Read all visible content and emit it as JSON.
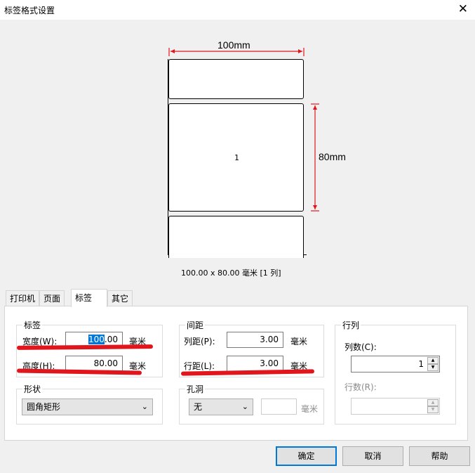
{
  "window": {
    "title": "标签格式设置",
    "close_glyph": "✕"
  },
  "preview": {
    "width_dim": "100mm",
    "height_dim": "80mm",
    "label_number": "1",
    "summary": "100.00 x 80.00 毫米 [1 列]",
    "accent_color": "#e0161c"
  },
  "tabs": [
    {
      "label": "打印机"
    },
    {
      "label": "页面"
    },
    {
      "label": "标签"
    },
    {
      "label": "其它"
    }
  ],
  "label_group": {
    "title": "标签",
    "width_label": "宽度(W):",
    "width_value_selected": "100",
    "width_value_rest": ".00",
    "width_unit": "毫米",
    "height_label": "高度(H):",
    "height_value": "80.00",
    "height_unit": "毫米"
  },
  "spacing_group": {
    "title": "间距",
    "col_label": "列距(P):",
    "col_value": "3.00",
    "col_unit": "毫米",
    "row_label": "行距(L):",
    "row_value": "3.00",
    "row_unit": "毫米"
  },
  "layout_group": {
    "title": "行列",
    "cols_label": "列数(C):",
    "cols_value": "1",
    "rows_label": "行数(R):",
    "rows_value": ""
  },
  "shape_group": {
    "title": "形状",
    "selected": "圆角矩形"
  },
  "hole_group": {
    "title": "孔洞",
    "selected": "无",
    "size_value": "",
    "unit": "毫米"
  },
  "buttons": {
    "ok": "确定",
    "cancel": "取消",
    "help": "帮助"
  }
}
